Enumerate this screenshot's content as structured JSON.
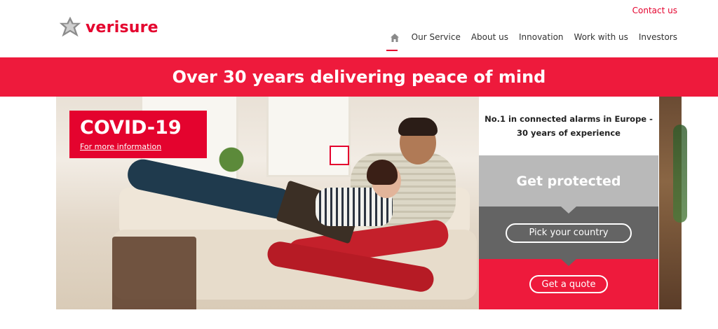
{
  "header": {
    "logo_text": "verisure",
    "contact_label": "Contact us",
    "nav": [
      {
        "label": "Our Service"
      },
      {
        "label": "About us"
      },
      {
        "label": "Innovation"
      },
      {
        "label": "Work with us"
      },
      {
        "label": "Investors"
      }
    ]
  },
  "banner": {
    "headline": "Over 30 years delivering peace of mind"
  },
  "covid": {
    "title": "COVID-19",
    "link": "For more information"
  },
  "panel": {
    "tagline_line1": "No.1 in connected alarms in Europe -",
    "tagline_line2": "30 years of experience",
    "get_protected": "Get protected",
    "country_button": "Pick your country",
    "quote_button": "Get a quote"
  },
  "colors": {
    "brand_red": "#e4032e",
    "banner_red": "#ee1a3c",
    "panel_light_grey": "#b9b9b9",
    "panel_dark_grey": "#646464"
  },
  "icons": [
    "logo-mark-icon",
    "home-icon"
  ]
}
